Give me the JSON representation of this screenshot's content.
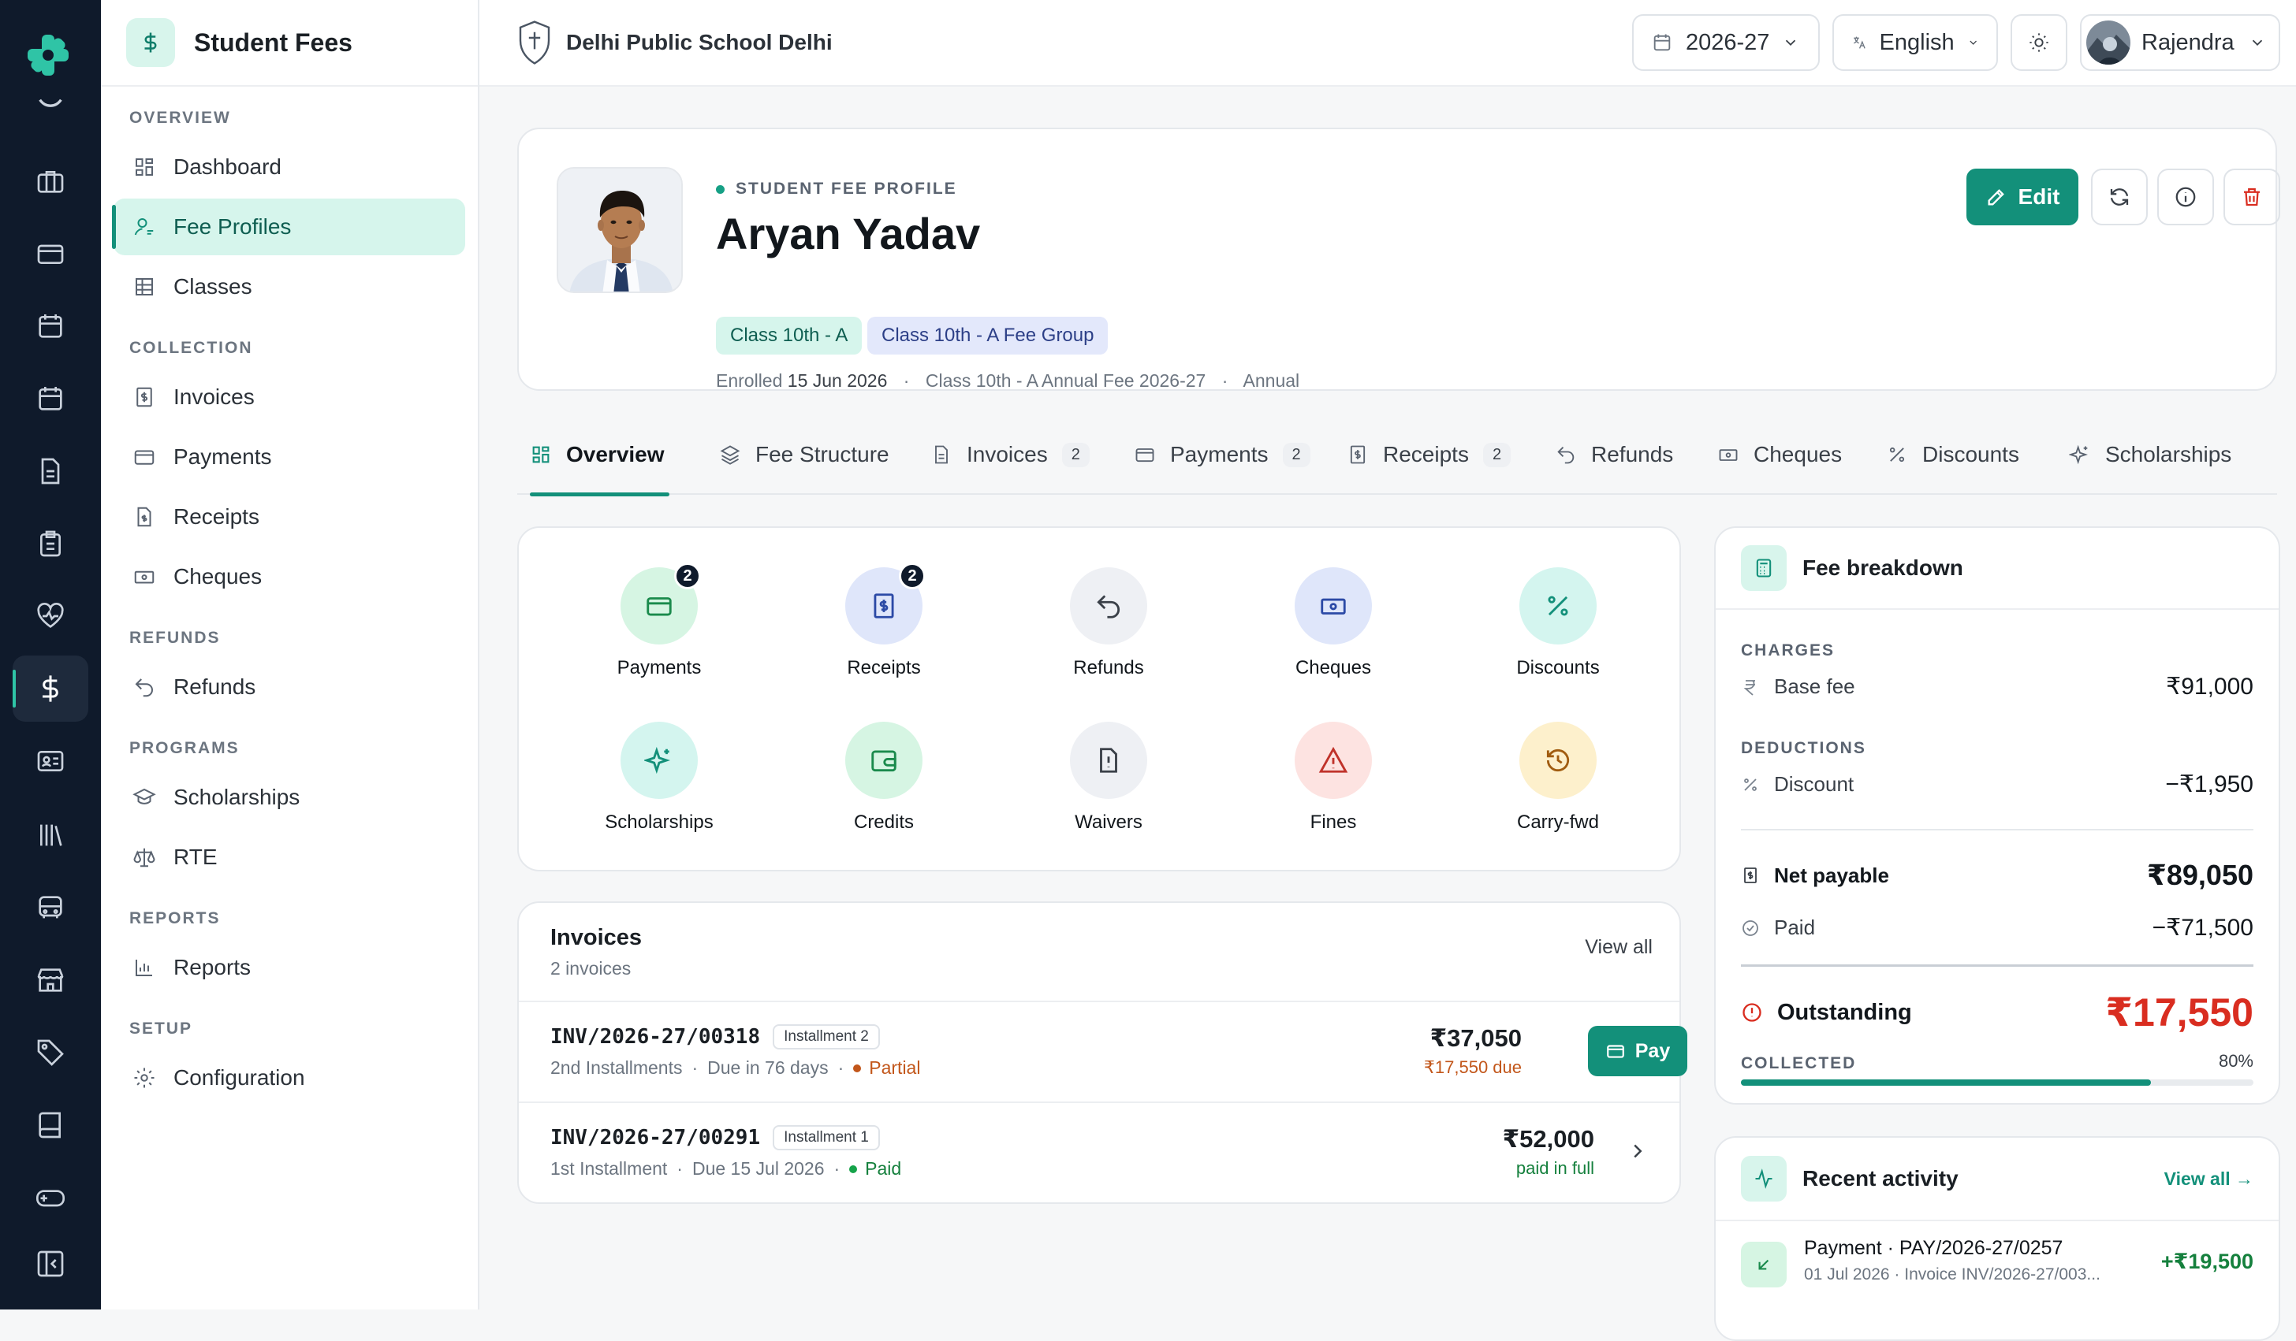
{
  "sidebar": {
    "title": "Student Fees",
    "sections": {
      "overview": "OVERVIEW",
      "collection": "COLLECTION",
      "refunds": "REFUNDS",
      "programs": "PROGRAMS",
      "reports": "REPORTS",
      "setup": "SETUP"
    },
    "items": {
      "dashboard": "Dashboard",
      "fee_profiles": "Fee Profiles",
      "classes": "Classes",
      "invoices": "Invoices",
      "payments": "Payments",
      "receipts": "Receipts",
      "cheques": "Cheques",
      "refunds": "Refunds",
      "scholarships": "Scholarships",
      "rte": "RTE",
      "reports": "Reports",
      "configuration": "Configuration"
    },
    "active_item": "Fee Profiles"
  },
  "topbar": {
    "school": "Delhi Public School Delhi",
    "year": "2026-27",
    "language": "English",
    "user": "Rajendra"
  },
  "profile": {
    "eyebrow": "STUDENT FEE PROFILE",
    "name": "Aryan Yadav",
    "class_chip": "Class 10th - A",
    "group_chip": "Class 10th - A Fee Group",
    "enrolled_label": "Enrolled",
    "enrolled_date": "15 Jun 2026",
    "sep": "·",
    "structure": "Class 10th - A Annual Fee 2026-27",
    "frequency": "Annual",
    "edit_label": "Edit"
  },
  "tabs": {
    "overview": "Overview",
    "fee_structure": "Fee Structure",
    "invoices": "Invoices",
    "invoices_count": "2",
    "payments": "Payments",
    "payments_count": "2",
    "receipts": "Receipts",
    "receipts_count": "2",
    "refunds": "Refunds",
    "cheques": "Cheques",
    "discounts": "Discounts",
    "scholarships": "Scholarships",
    "active": "Overview"
  },
  "quick_actions": {
    "payments": "Payments",
    "payments_badge": "2",
    "receipts": "Receipts",
    "receipts_badge": "2",
    "refunds": "Refunds",
    "cheques": "Cheques",
    "discounts": "Discounts",
    "scholarships": "Scholarships",
    "credits": "Credits",
    "waivers": "Waivers",
    "fines": "Fines",
    "carry_fwd": "Carry-fwd"
  },
  "invoices": {
    "title": "Invoices",
    "subtitle": "2 invoices",
    "view_all": "View all",
    "rows": [
      {
        "number": "INV/2026-27/00318",
        "tag": "Installment 2",
        "desc": "2nd Installments",
        "due": "Due in 76 days",
        "status": "Partial",
        "amount": "₹37,050",
        "amount_sub": "₹17,550 due",
        "action": "Pay"
      },
      {
        "number": "INV/2026-27/00291",
        "tag": "Installment 1",
        "desc": "1st Installment",
        "due": "Due 15 Jul 2026",
        "status": "Paid",
        "amount": "₹52,000",
        "amount_sub": "paid in full"
      }
    ]
  },
  "fee_breakdown": {
    "title": "Fee breakdown",
    "charges_label": "CHARGES",
    "base_fee_label": "Base fee",
    "base_fee": "₹91,000",
    "deductions_label": "DEDUCTIONS",
    "discount_label": "Discount",
    "discount": "−₹1,950",
    "net_label": "Net payable",
    "net": "₹89,050",
    "paid_label": "Paid",
    "paid": "−₹71,500",
    "outstanding_label": "Outstanding",
    "outstanding": "₹17,550",
    "collected_label": "COLLECTED",
    "collected_pct_text": "80%",
    "collected_fraction": 0.8
  },
  "recent_activity": {
    "title": "Recent activity",
    "view_all": "View all →",
    "item_title": "Payment · PAY/2026-27/0257",
    "item_sub": "01 Jul 2026 · Invoice INV/2026-27/003...",
    "item_amount": "+₹19,500"
  },
  "colors": {
    "accent": "#13907a",
    "rail": "#0f1a2b",
    "danger": "#d92d20",
    "partial": "#c2561a"
  }
}
